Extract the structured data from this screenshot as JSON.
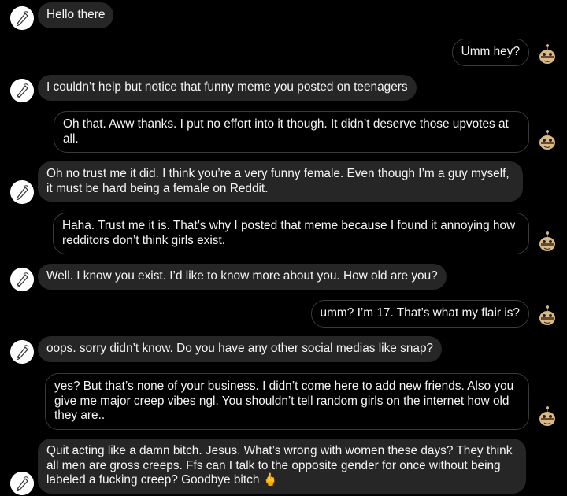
{
  "conversation": {
    "messages": [
      {
        "sender": "other",
        "text": "Hello there"
      },
      {
        "sender": "me",
        "text": "Umm hey?"
      },
      {
        "sender": "other",
        "text": "I couldn’t help but notice that funny meme you posted on teenagers"
      },
      {
        "sender": "me",
        "text": "Oh that. Aww thanks. I put no effort into it though. It didn’t deserve those upvotes at all."
      },
      {
        "sender": "other",
        "text": "Oh no trust me it did. I think you’re a very funny female. Even though I’m a guy myself, it must be hard being a female on Reddit."
      },
      {
        "sender": "me",
        "text": "Haha. Trust me it is. That’s why I posted that meme because I found it annoying how redditors don’t think girls exist."
      },
      {
        "sender": "other",
        "text": "Well. I know you exist. I’d like to know more about you. How old are you?"
      },
      {
        "sender": "me",
        "text": "umm? I’m 17. That’s what my flair is?"
      },
      {
        "sender": "other",
        "text": "oops. sorry didn’t know. Do you have any other social medias like snap?"
      },
      {
        "sender": "me",
        "text": "yes? But that’s none of your business. I didn’t come here to add new friends. Also you give me major creep vibes ngl. You shouldn’t tell random girls on the internet how old they are.."
      },
      {
        "sender": "other",
        "text": "Quit acting like a damn bitch. Jesus. What’s wrong with women these days? They think all men are gross creeps. Ffs can I talk to the opposite gender for once without being labeled a fucking creep? Goodbye bitch 🖕"
      }
    ]
  },
  "colors": {
    "background": "#000000",
    "incoming_bubble": "#262626",
    "outgoing_border": "#3a3a3a",
    "text": "#f5f5f5"
  },
  "icons": {
    "other_avatar": "sketch-avatar-icon",
    "my_avatar": "snoo-avatar-icon"
  }
}
